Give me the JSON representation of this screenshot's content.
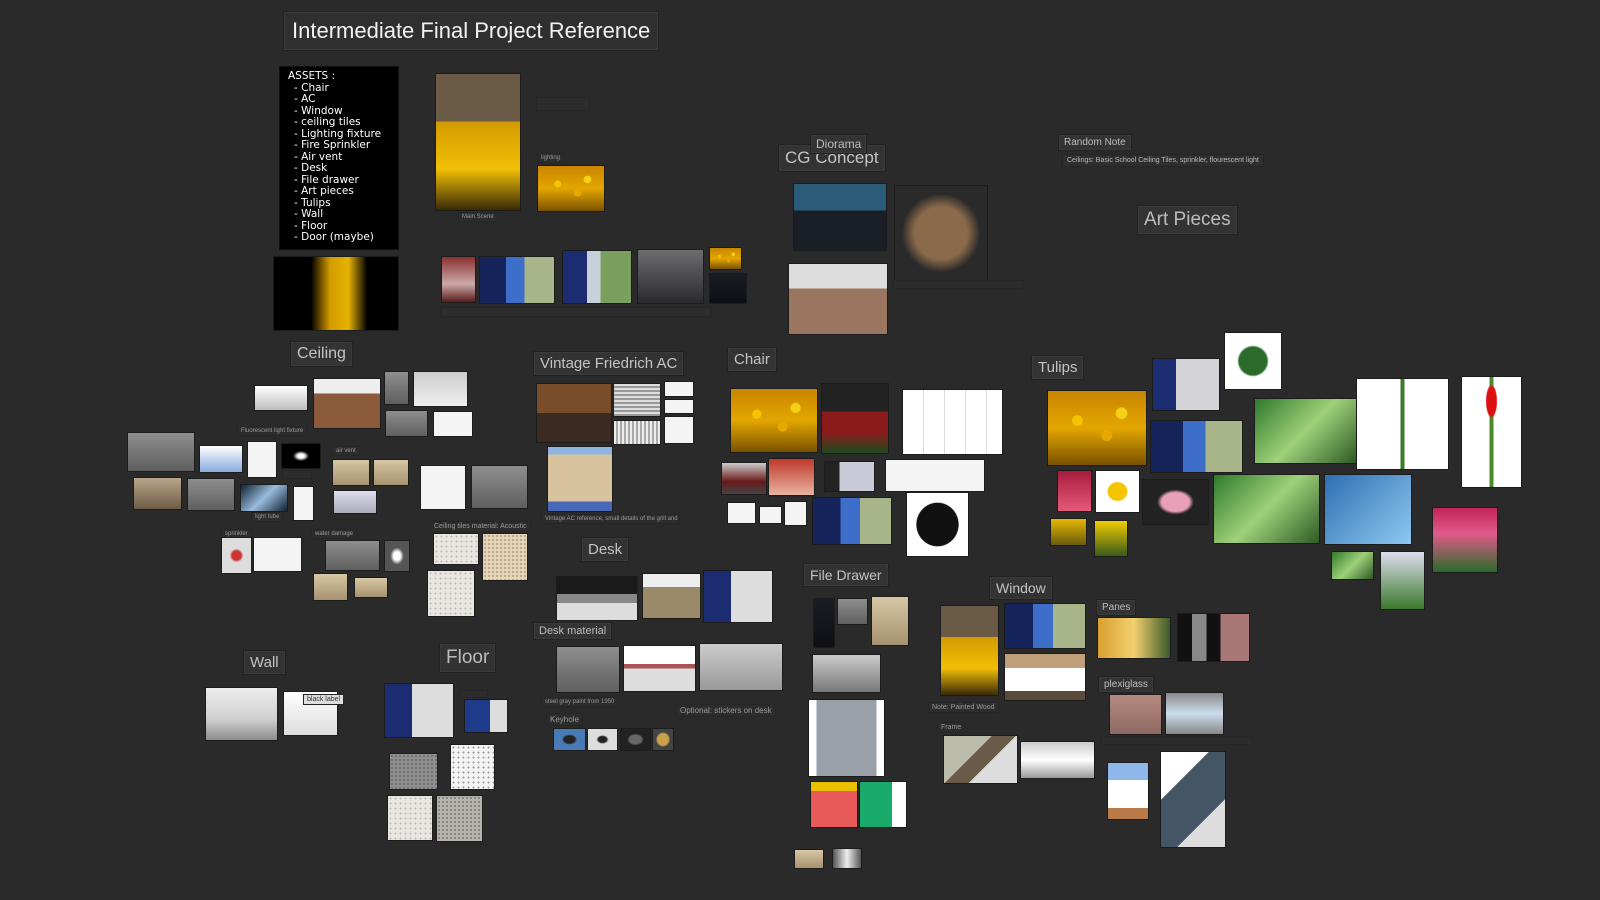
{
  "board": {
    "title": "Intermediate Final Project Reference",
    "assets_note": {
      "heading": "ASSETS :",
      "items": [
        "- Chair",
        "- AC",
        "- Window",
        "- ceiling tiles",
        "- Lighting fixture",
        "- Fire Sprinkler",
        "- Air vent",
        "- Desk",
        "- File drawer",
        "- Art pieces",
        "- Tulips",
        "- Wall",
        "- Floor",
        "- Door (maybe)"
      ]
    },
    "headings": {
      "ceiling": "Ceiling",
      "vintage_ac": "Vintage Friedrich AC",
      "chair": "Chair",
      "diorama": "Diorama",
      "cg_concept": "CG Concept",
      "tulips": "Tulips",
      "art_pieces": "Art Pieces",
      "desk": "Desk",
      "file_drawer": "File Drawer",
      "window": "Window",
      "wall": "Wall",
      "floor": "Floor"
    },
    "small_labels": {
      "random_note": "Random Note",
      "desk_material": "Desk material",
      "keyhole": "Keyhole",
      "panes": "Panes",
      "plexiglass": "plexiglass",
      "frame": "Frame",
      "lighting": "lighting",
      "main_scene": "Main Scene"
    },
    "notes": {
      "random_note_text": "Ceilings: Basic School Ceiling Tiles, sprinkler, flourescent light",
      "ceiling_material": "Ceiling tiles material: Acoustic",
      "optional_stickers": "Optional: stickers on desk",
      "window_note": "Note: Painted Wood",
      "black_label": "black label",
      "ac_caption": "Vintage AC reference, small details of the grill and knobs",
      "fluorescent": "Fluorescent light fixture",
      "water_damage": "water damage",
      "sprinkler": "sprinkler",
      "air_vent": "air vent",
      "light_tube": "light tube",
      "desk_paint": "steel gray paint from 1950"
    }
  }
}
